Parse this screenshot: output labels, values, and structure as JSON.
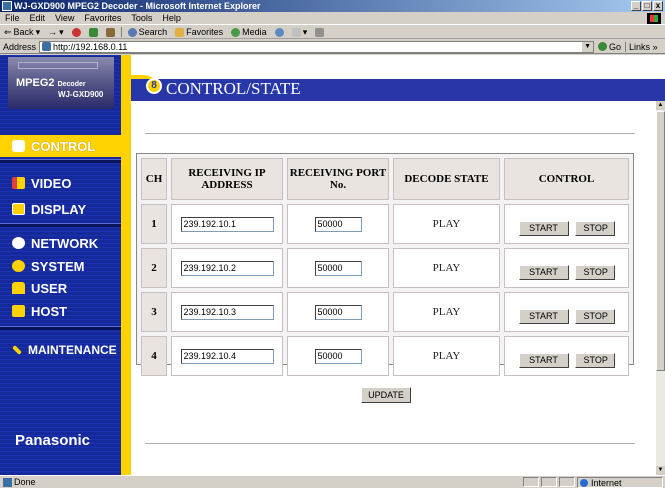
{
  "window": {
    "title": "WJ-GXD900 MPEG2 Decoder - Microsoft Internet Explorer",
    "controls": [
      "_",
      "2",
      "x"
    ]
  },
  "menu": [
    "File",
    "Edit",
    "View",
    "Favorites",
    "Tools",
    "Help"
  ],
  "toolbar": {
    "back": "Back",
    "search": "Search",
    "favorites": "Favorites",
    "media": "Media"
  },
  "address": {
    "label": "Address",
    "url": "http://192.168.0.11",
    "go": "Go",
    "links": "Links"
  },
  "sidebar": {
    "logo_model": "MPEG2",
    "logo_sub": "Decoder",
    "logo_number": "WJ-GXD900",
    "items": [
      {
        "label": "CONTROL",
        "icon": "lock-icon",
        "active": true
      },
      {
        "label": "VIDEO",
        "icon": "video-icon",
        "active": false
      },
      {
        "label": "DISPLAY",
        "icon": "display-icon",
        "active": false
      },
      {
        "label": "NETWORK",
        "icon": "network-icon",
        "active": false
      },
      {
        "label": "SYSTEM",
        "icon": "system-icon",
        "active": false
      },
      {
        "label": "USER",
        "icon": "user-icon",
        "active": false
      },
      {
        "label": "HOST",
        "icon": "host-icon",
        "active": false
      },
      {
        "label": "MAINTENANCE",
        "icon": "wrench-icon",
        "active": false
      }
    ],
    "brand": "Panasonic"
  },
  "page": {
    "title": "CONTROL/STATE"
  },
  "table": {
    "headers": {
      "ch": "CH",
      "ip": "RECEIVING IP ADDRESS",
      "port": "RECEIVING PORT No.",
      "state": "DECODE STATE",
      "control": "CONTROL"
    },
    "rows": [
      {
        "ch": "1",
        "ip": "239.192.10.1",
        "port": "50000",
        "state": "PLAY",
        "start": "START",
        "stop": "STOP"
      },
      {
        "ch": "2",
        "ip": "239.192.10.2",
        "port": "50000",
        "state": "PLAY",
        "start": "START",
        "stop": "STOP"
      },
      {
        "ch": "3",
        "ip": "239.192.10.3",
        "port": "50000",
        "state": "PLAY",
        "start": "START",
        "stop": "STOP"
      },
      {
        "ch": "4",
        "ip": "239.192.10.4",
        "port": "50000",
        "state": "PLAY",
        "start": "START",
        "stop": "STOP"
      }
    ],
    "update": "UPDATE"
  },
  "status": {
    "text": "Done",
    "zone": "Internet"
  },
  "colors": {
    "sidebar_blue": "#1b33b0",
    "header_blue": "#2837a8",
    "accent_yellow": "#ffd200"
  }
}
